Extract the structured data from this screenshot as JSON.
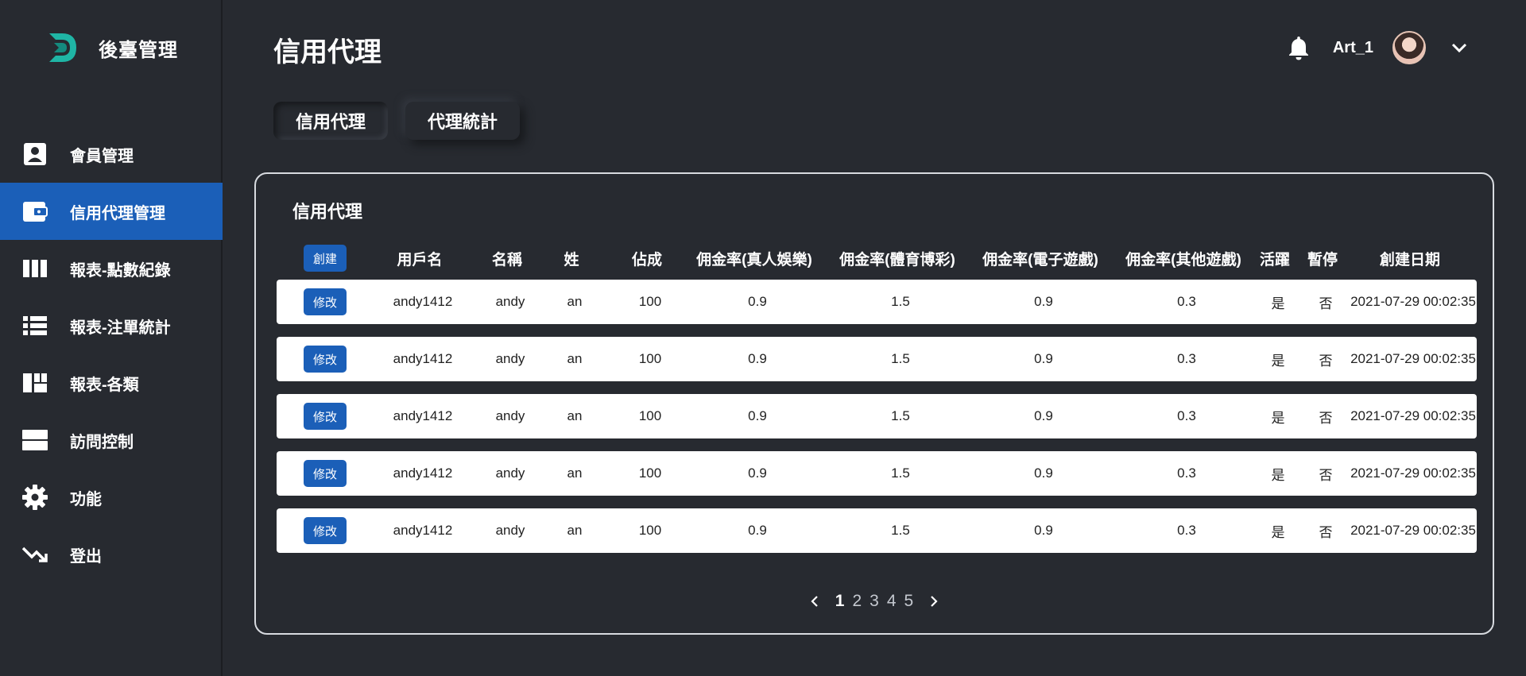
{
  "brand": {
    "title": "後臺管理"
  },
  "sidebar": {
    "items": [
      {
        "label": "會員管理",
        "icon": "user-card-icon"
      },
      {
        "label": "信用代理管理",
        "icon": "wallet-icon",
        "active": true
      },
      {
        "label": "報表-點數紀錄",
        "icon": "columns-icon"
      },
      {
        "label": "報表-注單統計",
        "icon": "list-icon"
      },
      {
        "label": "報表-各類",
        "icon": "dashboard-icon"
      },
      {
        "label": "訪問控制",
        "icon": "storage-icon"
      },
      {
        "label": "功能",
        "icon": "gear-icon"
      },
      {
        "label": "登出",
        "icon": "trend-down-icon"
      }
    ]
  },
  "header": {
    "title": "信用代理",
    "username": "Art_1"
  },
  "tabs": [
    {
      "label": "信用代理"
    },
    {
      "label": "代理統計"
    }
  ],
  "panel": {
    "title": "信用代理",
    "create_label": "創建",
    "edit_label": "修改",
    "columns": [
      "用戶名",
      "名稱",
      "姓",
      "佔成",
      "佣金率(真人娛樂)",
      "佣金率(體育博彩)",
      "佣金率(電子遊戲)",
      "佣金率(其他遊戲)",
      "活躍",
      "暫停",
      "創建日期"
    ],
    "rows": [
      [
        "andy1412",
        "andy",
        "an",
        "100",
        "0.9",
        "1.5",
        "0.9",
        "0.3",
        "是",
        "否",
        "2021-07-29 00:02:35"
      ],
      [
        "andy1412",
        "andy",
        "an",
        "100",
        "0.9",
        "1.5",
        "0.9",
        "0.3",
        "是",
        "否",
        "2021-07-29 00:02:35"
      ],
      [
        "andy1412",
        "andy",
        "an",
        "100",
        "0.9",
        "1.5",
        "0.9",
        "0.3",
        "是",
        "否",
        "2021-07-29 00:02:35"
      ],
      [
        "andy1412",
        "andy",
        "an",
        "100",
        "0.9",
        "1.5",
        "0.9",
        "0.3",
        "是",
        "否",
        "2021-07-29 00:02:35"
      ],
      [
        "andy1412",
        "andy",
        "an",
        "100",
        "0.9",
        "1.5",
        "0.9",
        "0.3",
        "是",
        "否",
        "2021-07-29 00:02:35"
      ]
    ]
  },
  "pagination": {
    "pages": [
      "1",
      "2",
      "3",
      "4",
      "5"
    ],
    "current": "1"
  },
  "colors": {
    "background": "#272a30",
    "accent": "#1b5fb8",
    "logo": "#1fb5a5"
  }
}
